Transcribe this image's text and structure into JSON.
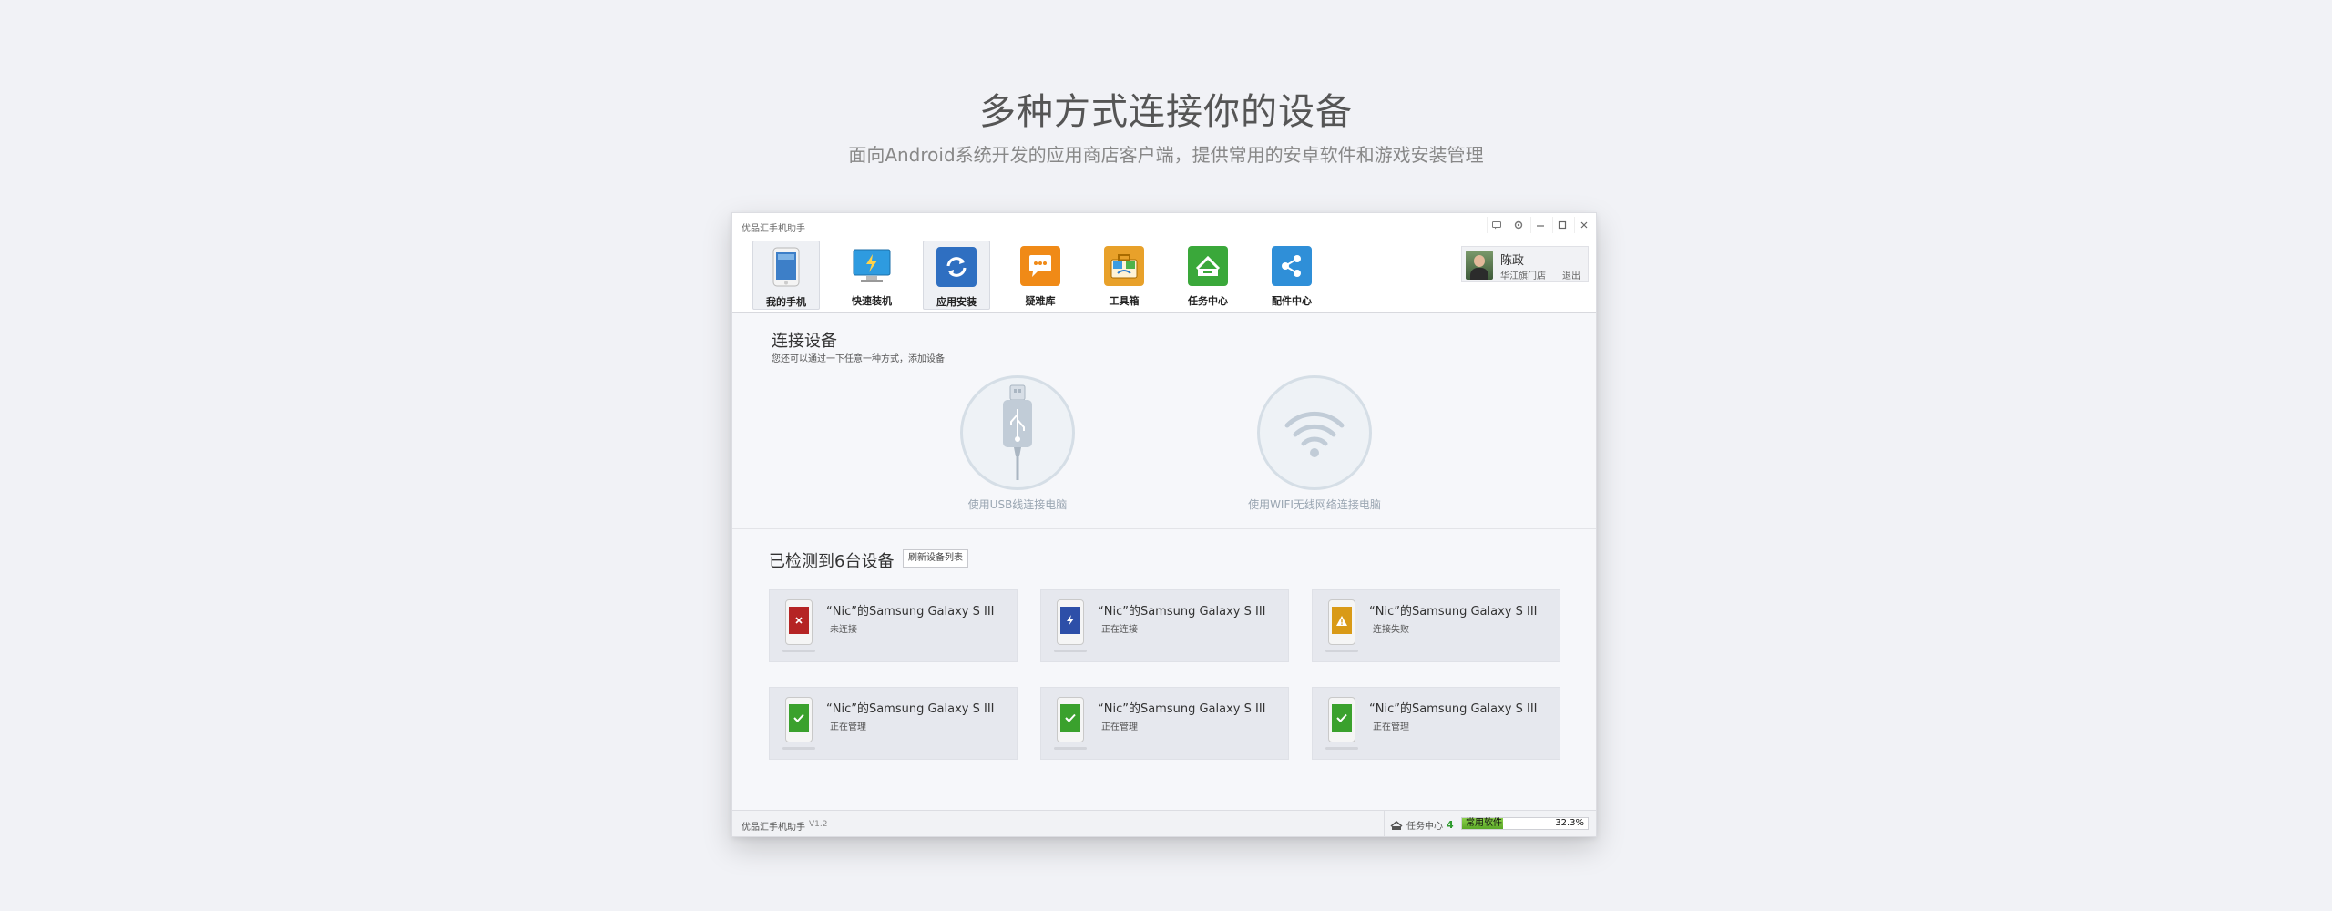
{
  "hero": {
    "title": "多种方式连接你的设备",
    "subtitle": "面向Android系统开发的应用商店客户端，提供常用的安卓软件和游戏安装管理"
  },
  "window": {
    "app_title": "优品汇手机助手",
    "controls": [
      "message-icon",
      "settings-icon",
      "minimize-icon",
      "maximize-icon",
      "close-icon"
    ]
  },
  "toolbar": {
    "items": [
      {
        "label": "我的手机",
        "icon": "phone-icon",
        "color": "#3d7fc8",
        "active": true
      },
      {
        "label": "快速装机",
        "icon": "monitor-icon",
        "color": "#2e9be0",
        "active": false
      },
      {
        "label": "应用安装",
        "icon": "refresh-install-icon",
        "color": "#2f6fc1",
        "active": true
      },
      {
        "label": "疑难库",
        "icon": "chat-bubble-icon",
        "color": "#f08a17",
        "active": false
      },
      {
        "label": "工具箱",
        "icon": "toolbox-icon",
        "color": "#e8a12a",
        "active": false
      },
      {
        "label": "任务中心",
        "icon": "task-center-icon",
        "color": "#3aa83a",
        "active": false
      },
      {
        "label": "配件中心",
        "icon": "share-icon",
        "color": "#2f8fd8",
        "active": false
      }
    ]
  },
  "user": {
    "name": "陈政",
    "store": "华江旗门店",
    "logout": "退出"
  },
  "connect": {
    "title": "连接设备",
    "subtitle": "您还可以通过一下任意一种方式，添加设备",
    "usb_label": "使用USB线连接电脑",
    "wifi_label": "使用WIFI无线网络连接电脑"
  },
  "detected": {
    "title": "已检测到6台设备",
    "refresh_label": "刷新设备列表",
    "devices": [
      {
        "name": "“Nic”的Samsung Galaxy S III",
        "status": "未连接",
        "state_color": "#b52424",
        "state_icon": "x-icon"
      },
      {
        "name": "“Nic”的Samsung Galaxy S III",
        "status": "正在连接",
        "state_color": "#2d4fa8",
        "state_icon": "lightning-icon"
      },
      {
        "name": "“Nic”的Samsung Galaxy S III",
        "status": "连接失败",
        "state_color": "#d99a17",
        "state_icon": "warning-icon"
      },
      {
        "name": "“Nic”的Samsung Galaxy S III",
        "status": "正在管理",
        "state_color": "#3aa12d",
        "state_icon": "check-icon"
      },
      {
        "name": "“Nic”的Samsung Galaxy S III",
        "status": "正在管理",
        "state_color": "#3aa12d",
        "state_icon": "check-icon"
      },
      {
        "name": "“Nic”的Samsung Galaxy S III",
        "status": "正在管理",
        "state_color": "#3aa12d",
        "state_icon": "check-icon"
      }
    ]
  },
  "statusbar": {
    "app_name": "优品汇手机助手",
    "version": "V1.2",
    "task_label": "任务中心",
    "task_count": "4",
    "progress_label": "常用软件",
    "progress_percent": "32.3%",
    "progress_value": 0.323
  }
}
